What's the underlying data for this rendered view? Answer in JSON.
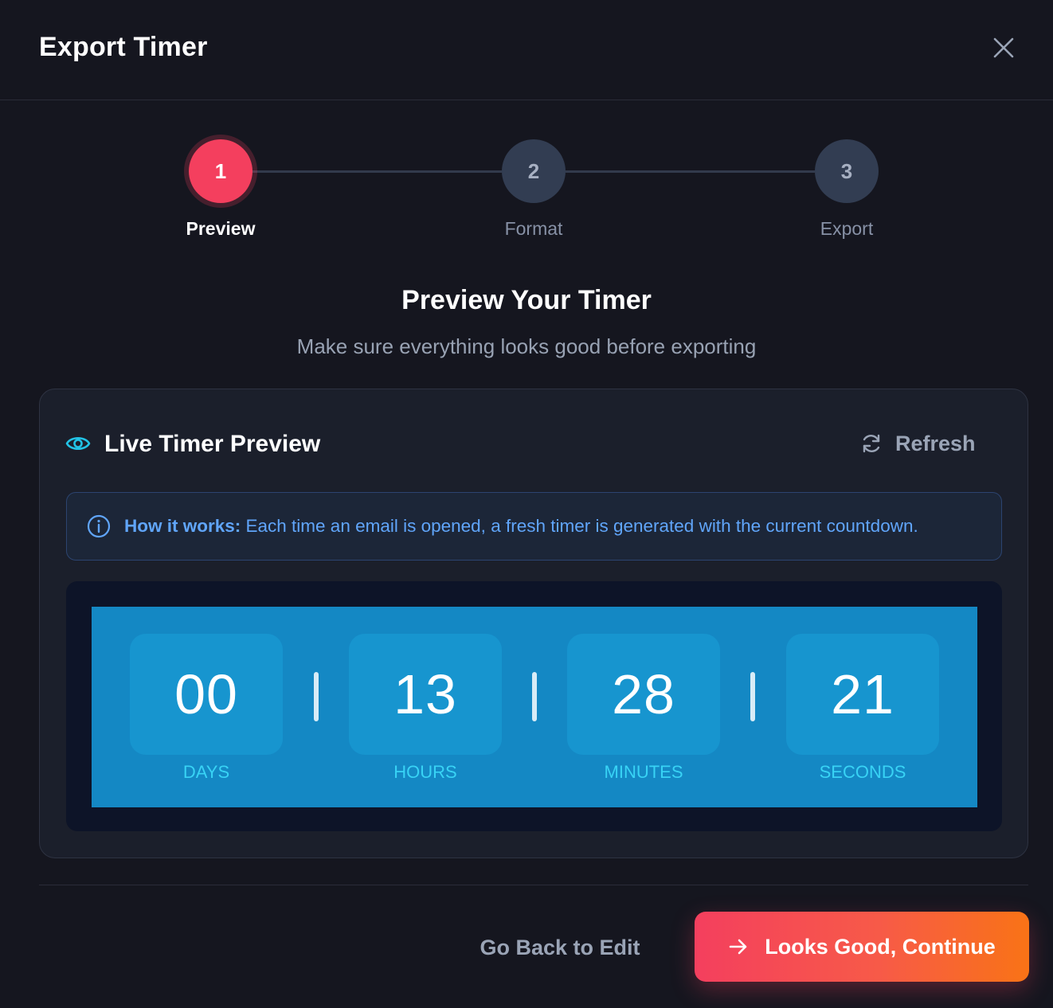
{
  "header": {
    "title": "Export Timer",
    "close_icon": "close-icon"
  },
  "stepper": {
    "steps": [
      {
        "number": "1",
        "label": "Preview",
        "state": "active"
      },
      {
        "number": "2",
        "label": "Format",
        "state": "inactive"
      },
      {
        "number": "3",
        "label": "Export",
        "state": "inactive"
      }
    ]
  },
  "section": {
    "title": "Preview Your Timer",
    "subtitle": "Make sure everything looks good before exporting"
  },
  "preview_card": {
    "title": "Live Timer Preview",
    "title_icon": "eye-icon",
    "refresh_label": "Refresh",
    "refresh_icon": "refresh-icon",
    "info": {
      "icon": "info-icon",
      "label": "How it works:",
      "text": " Each time an email is opened, a fresh timer is generated with the current countdown."
    },
    "timer": {
      "units": [
        {
          "value": "00",
          "label": "DAYS"
        },
        {
          "value": "13",
          "label": "HOURS"
        },
        {
          "value": "28",
          "label": "MINUTES"
        },
        {
          "value": "21",
          "label": "SECONDS"
        }
      ]
    }
  },
  "footer": {
    "back_label": "Go Back to Edit",
    "continue_label": "Looks Good, Continue",
    "continue_icon": "arrow-right-icon"
  },
  "colors": {
    "accent": "#f43f5e",
    "accent_end": "#f97316",
    "timer_bg": "#1488c4",
    "info_text": "#60a5fa",
    "unit_label": "#38d3f5"
  }
}
